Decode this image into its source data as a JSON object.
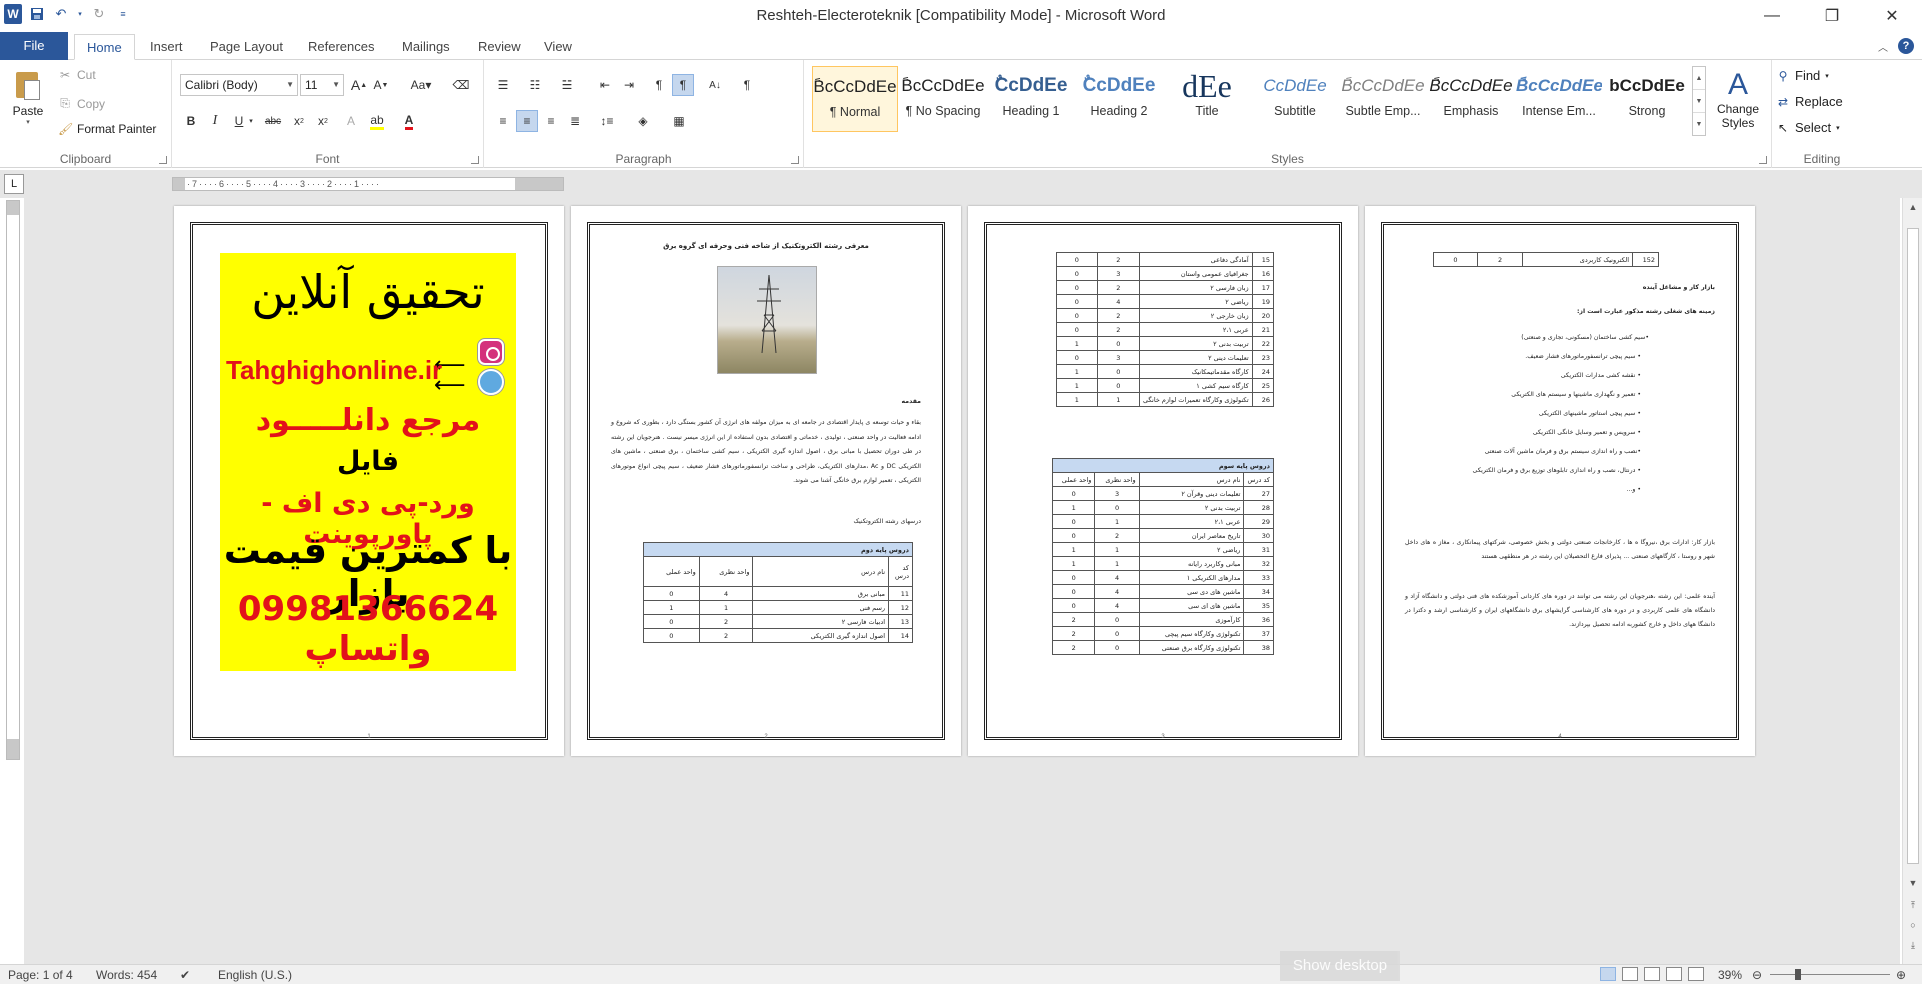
{
  "window": {
    "title": "Reshteh-Electeroteknik [Compatibility Mode]  -  Microsoft Word",
    "controls": [
      "minimize-icon",
      "restore-icon",
      "close-icon"
    ]
  },
  "quick_access": [
    "save-icon",
    "undo-icon",
    "redo-icon",
    "customize-icon"
  ],
  "tabs": [
    "File",
    "Home",
    "Insert",
    "Page Layout",
    "References",
    "Mailings",
    "Review",
    "View"
  ],
  "ribbon": {
    "clipboard": {
      "label": "Clipboard",
      "paste": "Paste",
      "cut": "Cut",
      "copy": "Copy",
      "format_painter": "Format Painter"
    },
    "font": {
      "label": "Font",
      "family": "Calibri (Body)",
      "size": "11"
    },
    "paragraph": {
      "label": "Paragraph"
    },
    "styles": {
      "label": "Styles",
      "items": [
        {
          "sample": "ًBcCcDdEe",
          "name": "¶ Normal"
        },
        {
          "sample": "ًBcCcDdEe",
          "name": "¶ No Spacing"
        },
        {
          "sample": "ٌCcDdEe",
          "name": "Heading 1"
        },
        {
          "sample": "ٌCcDdEe",
          "name": "Heading 2"
        },
        {
          "sample": "dEe",
          "name": "Title"
        },
        {
          "sample": "CcDdEe",
          "name": "Subtitle"
        },
        {
          "sample": "ًBcCcDdEe",
          "name": "Subtle Emp..."
        },
        {
          "sample": "ًBcCcDdEe",
          "name": "Emphasis"
        },
        {
          "sample": "ًBcCcDdEe",
          "name": "Intense Em..."
        },
        {
          "sample": "bCcDdEe",
          "name": "Strong"
        }
      ],
      "change_styles": "Change Styles"
    },
    "editing": {
      "label": "Editing",
      "find": "Find",
      "replace": "Replace",
      "select": "Select"
    }
  },
  "ruler": {
    "marks": "·7····6····5····4····3····2····1····"
  },
  "page1": {
    "ad_title": "تحقیق آنلاین",
    "ad_site": "Tahghighonline.ir",
    "ad_ref": "مرجع دانلـــــود",
    "ad_file": "فایل",
    "ad_formats": "ورد-پی دی اف - پاورپوینت",
    "ad_price": "با کمترین قیمت بازار",
    "ad_phone": "09981366624 واتساپ",
    "page_number": "1"
  },
  "page2": {
    "title": "معرفی رشته الکتروتکنیک از شاخه فنی وحرفه ای گروه برق",
    "intro_heading": "مقدمه",
    "intro_text": "بقاء و حیات توسعه ی پایدار اقتصادی در جامعه ای به میزان مولفه های انرژی آن کشور بستگی دارد ، بطوری که شروع و ادامه فعالیت در واحد صنعتی ، تولیدی ، خدماتی و اقتصادی بدون استفاده از این انرژی میسر نیست . هنرجویان این رشته در طی دوران تحصیل با مبانی برق ، اصول اندازه گیری الکتریکی ، سیم کشی ساختمان ، برق صنعتی ، ماشین های الکتریکی DC و Ac ،مدارهای الکتریکی، طراحی و ساخت ترانسفورماتورهای فشار ضعیف ، سیم پیچی انواع موتورهای الکتریکی ، تعمیر لوازم برق خانگی آشنا می شوند.",
    "courses_heading": "درسهای رشته الکتروتکنیک",
    "table_title": "دروس پایه دوم",
    "table_header": [
      "کد درس",
      "نام درس",
      "واحد نظری",
      "واحد عملی"
    ],
    "rows": [
      [
        "11",
        "مبانی برق",
        "4",
        "0"
      ],
      [
        "12",
        "رسم فنی",
        "1",
        "1"
      ],
      [
        "13",
        "ادبیات فارسی ۲",
        "2",
        "0"
      ],
      [
        "14",
        "اصول اندازه گیری الکتریکی",
        "2",
        "0"
      ]
    ],
    "page_number": "2"
  },
  "page3": {
    "rows_top": [
      [
        "15",
        "آمادگی دفاعی",
        "2",
        "0"
      ],
      [
        "16",
        "جغرافیای عمومی واستان",
        "3",
        "0"
      ],
      [
        "17",
        "زبان فارسی ۲",
        "2",
        "0"
      ],
      [
        "19",
        "ریاضی ۲",
        "4",
        "0"
      ],
      [
        "20",
        "زبان خارجی ۲",
        "2",
        "0"
      ],
      [
        "21",
        "عربی ۲،۱",
        "2",
        "0"
      ],
      [
        "22",
        "تربیت بدنی ۲",
        "0",
        "1"
      ],
      [
        "23",
        "تعلیمات دینی ۲",
        "3",
        "0"
      ],
      [
        "24",
        "کارگاه مقدماتیمکانیک",
        "0",
        "1"
      ],
      [
        "25",
        "کارگاه سیم کشی ۱",
        "0",
        "1"
      ],
      [
        "26",
        "تکنولوژی وکارگاه تعمیرات لوازم خانگی",
        "1",
        "1"
      ]
    ],
    "table_title": "دروس پایه سوم",
    "table_header": [
      "کد درس",
      "نام درس",
      "واحد نظری",
      "واحد عملی"
    ],
    "rows_bottom": [
      [
        "27",
        "تعلیمات دینی وقرآن ۲",
        "3",
        "0"
      ],
      [
        "28",
        "تربیت بدنی ۲",
        "0",
        "1"
      ],
      [
        "29",
        "عربی ۲،۱",
        "1",
        "0"
      ],
      [
        "30",
        "تاریخ معاصر ایران",
        "2",
        "0"
      ],
      [
        "31",
        "ریاضی ۲",
        "1",
        "1"
      ],
      [
        "32",
        "مبانی وکاربرد رایانه",
        "1",
        "1"
      ],
      [
        "33",
        "مدارهای الکتریکی ۱",
        "4",
        "0"
      ],
      [
        "34",
        "ماشین های دی سی",
        "4",
        "0"
      ],
      [
        "35",
        "ماشین های ای سی",
        "4",
        "0"
      ],
      [
        "36",
        "کارآموزی",
        "0",
        "2"
      ],
      [
        "37",
        "تکنولوژی وکارگاه سیم پیچی",
        "0",
        "2"
      ],
      [
        "38",
        "تکنولوژی وکارگاه برق صنعتی",
        "0",
        "2"
      ]
    ],
    "page_number": "3"
  },
  "page4": {
    "top_row": [
      "152",
      "الکترونیک کاربردی",
      "2",
      "0"
    ],
    "market_heading": "بازار کار و مشاغل آینده",
    "fields_heading": "زمینه های شغلی رشته مذکور عبارت است از:",
    "fields": [
      "•سیم کشی ساختمان (مسکونی، تجاری و صنعتی)",
      "• سیم پیچی ترانسفورماتورهای فشار ضعیف.",
      "• نقشه کشی مدارات الکتریکی",
      "• تعمیر و نگهداری ماشینها و سیستم های الکتریکی",
      "• سیم پیچی استاتور ماشینهای الکتریکی",
      "• سرویس و تعمیر وسایل خانگی الکتریکی",
      "•نصب و راه اندازی سیستم برق و فرمان ماشین آلات صنعتی",
      "• درنتال، نصب و راه اندازی تابلوهای توزیع برق و فرمان الکتریکی",
      "• و..."
    ],
    "market_text": "بازار کار: ادارات برق ،نیروگا ه ها ، کارخانجات صنعتی دولتی و بخش خصوصی، شرکتهای پیمانکاری ، مغاز ه های داخل شهر و روستا ، کارگاههای صنعتی ... پذیرای فارغ التحصیلان این رشته در هر منطقهی هستند",
    "future_text": "آینده علمی: این رشته ،هنرجویان این رشته می توانند در دوره های کاردانی آموزشکده های فنی دولتی و دانشگاه آزاد و دانشگاه های علمی کاربردی و در دوره های کارشناسی گرایشهای برق دانشگاههای ایران و کارشناسی ارشد و دکترا در دانشگا ههای داخل و خارج کشوربه ادامه تحصیل بپردازند.",
    "page_number": "4"
  },
  "status": {
    "page": "Page: 1 of 4",
    "words": "Words: 454",
    "language": "English (U.S.)",
    "show_desktop": "Show desktop",
    "zoom": "39%"
  },
  "colors": {
    "accent": "#2b579a",
    "ad_yellow": "#ffff00",
    "ad_red": "#e2121b",
    "table_head": "#c6d9f1"
  }
}
